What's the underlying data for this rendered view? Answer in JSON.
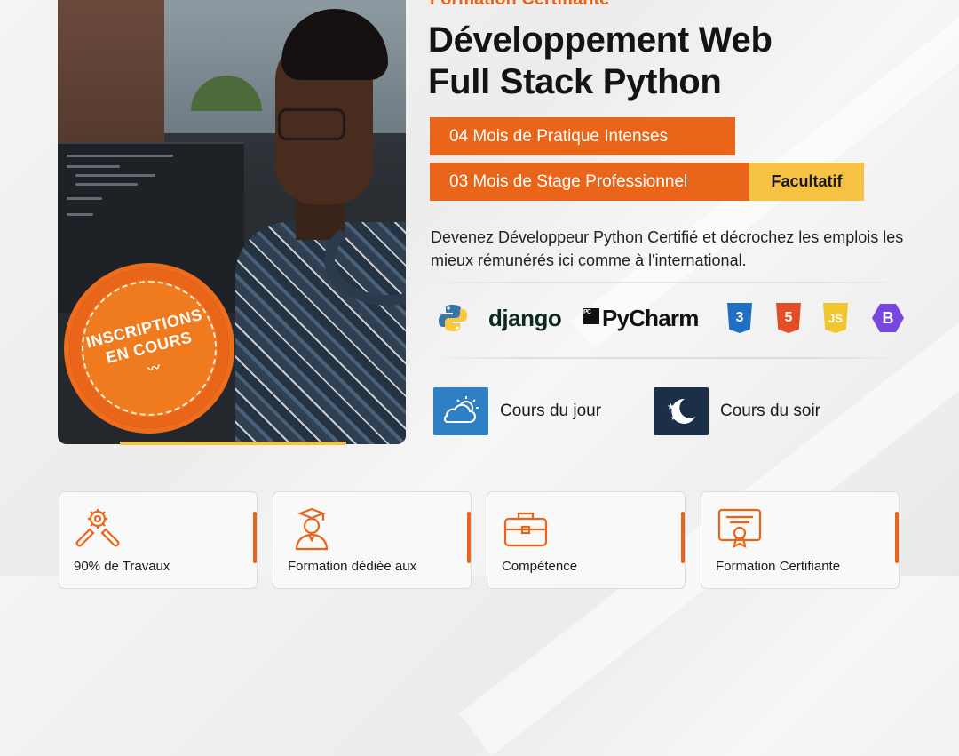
{
  "header": {
    "kicker": "Formation Certifiante",
    "title_line1": "Développement Web",
    "title_line2": "Full Stack Python"
  },
  "tags": {
    "practice": "04 Mois de Pratique Intenses",
    "internship": "03 Mois de Stage Professionnel",
    "optional": "Facultatif"
  },
  "description": "Devenez Développeur Python Certifié et décrochez les emplois les mieux rémunérés ici comme à l'international.",
  "badge": {
    "line1": "INSCRIPTIONS",
    "line2": "EN COURS"
  },
  "logos": {
    "django": "django",
    "pycharm": "PyCharm",
    "pycharm_mark": "PC",
    "css3": "3",
    "html5": "5",
    "js": "JS",
    "bootstrap": "B",
    "icons": [
      "python-logo-icon",
      "django-logo-icon",
      "pycharm-logo-icon",
      "css3-logo-icon",
      "html5-logo-icon",
      "javascript-logo-icon",
      "bootstrap-logo-icon"
    ]
  },
  "schedule": {
    "day_label": "Cours du jour",
    "evening_label": "Cours du soir"
  },
  "cards": [
    {
      "label": "90% de Travaux",
      "icon": "gear-wrench-icon"
    },
    {
      "label": "Formation dédiée aux",
      "icon": "graduate-icon"
    },
    {
      "label": "Compétence",
      "icon": "briefcase-icon"
    },
    {
      "label": "Formation Certifiante",
      "icon": "certificate-icon"
    }
  ],
  "colors": {
    "accent": "#e8651a",
    "highlight": "#f7c244",
    "day_icon_bg": "#2f7fc4",
    "night_icon_bg": "#1c2f48"
  }
}
